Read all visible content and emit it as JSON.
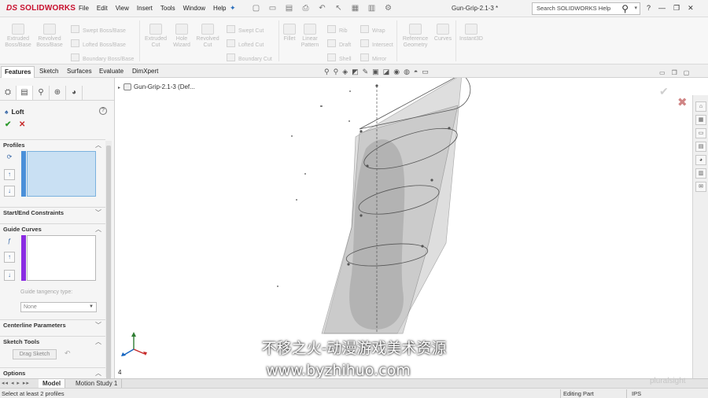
{
  "app": {
    "logo": "SOLIDWORKS",
    "logo_prefix": "DS",
    "document_title": "Gun-Grip-2.1-3 *",
    "menu": [
      "File",
      "Edit",
      "View",
      "Insert",
      "Tools",
      "Window",
      "Help"
    ],
    "help_search_placeholder": "Search SOLIDWORKS Help"
  },
  "ribbon": {
    "extruded_boss": "Extruded Boss/Base",
    "revolved_boss": "Revolved Boss/Base",
    "swept_boss": "Swept Boss/Base",
    "lofted_boss": "Lofted Boss/Base",
    "boundary_boss": "Boundary Boss/Base",
    "extruded_cut": "Extruded Cut",
    "hole_wizard": "Hole Wizard",
    "revolved_cut": "Revolved Cut",
    "swept_cut": "Swept Cut",
    "lofted_cut": "Lofted Cut",
    "boundary_cut": "Boundary Cut",
    "fillet": "Fillet",
    "linear_pattern": "Linear Pattern",
    "rib": "Rib",
    "draft": "Draft",
    "shell": "Shell",
    "wrap": "Wrap",
    "intersect": "Intersect",
    "mirror": "Mirror",
    "reference_geometry": "Reference Geometry",
    "curves": "Curves",
    "instant3d": "Instant3D"
  },
  "command_tabs": [
    "Features",
    "Sketch",
    "Surfaces",
    "Evaluate",
    "DimXpert"
  ],
  "property_manager": {
    "title": "Loft",
    "help": "?",
    "sections": {
      "profiles": "Profiles",
      "start_end": "Start/End Constraints",
      "guide_curves": "Guide Curves",
      "guide_tangency_label": "Guide tangency type:",
      "guide_tangency_value": "None",
      "centerline": "Centerline Parameters",
      "sketch_tools": "Sketch Tools",
      "drag_sketch": "Drag Sketch",
      "options": "Options"
    },
    "profile_bar_color": "#4a90d9",
    "guide_bar_color": "#8a2be2"
  },
  "tree": {
    "root": "Gun-Grip-2.1-3  (Def..."
  },
  "bottom_tabs": [
    "Model",
    "Motion Study 1"
  ],
  "nav_arrows": "◂◂ ◂ ▸ ▸▸",
  "status": {
    "message": "Select at least 2 profiles",
    "editing": "Editing Part",
    "units": "IPS"
  },
  "page_indicator": "4",
  "watermark": {
    "line1": "不移之火-动漫游戏美术资源",
    "line2": "www.byzhihuo.com",
    "brand": "pluralsight"
  }
}
